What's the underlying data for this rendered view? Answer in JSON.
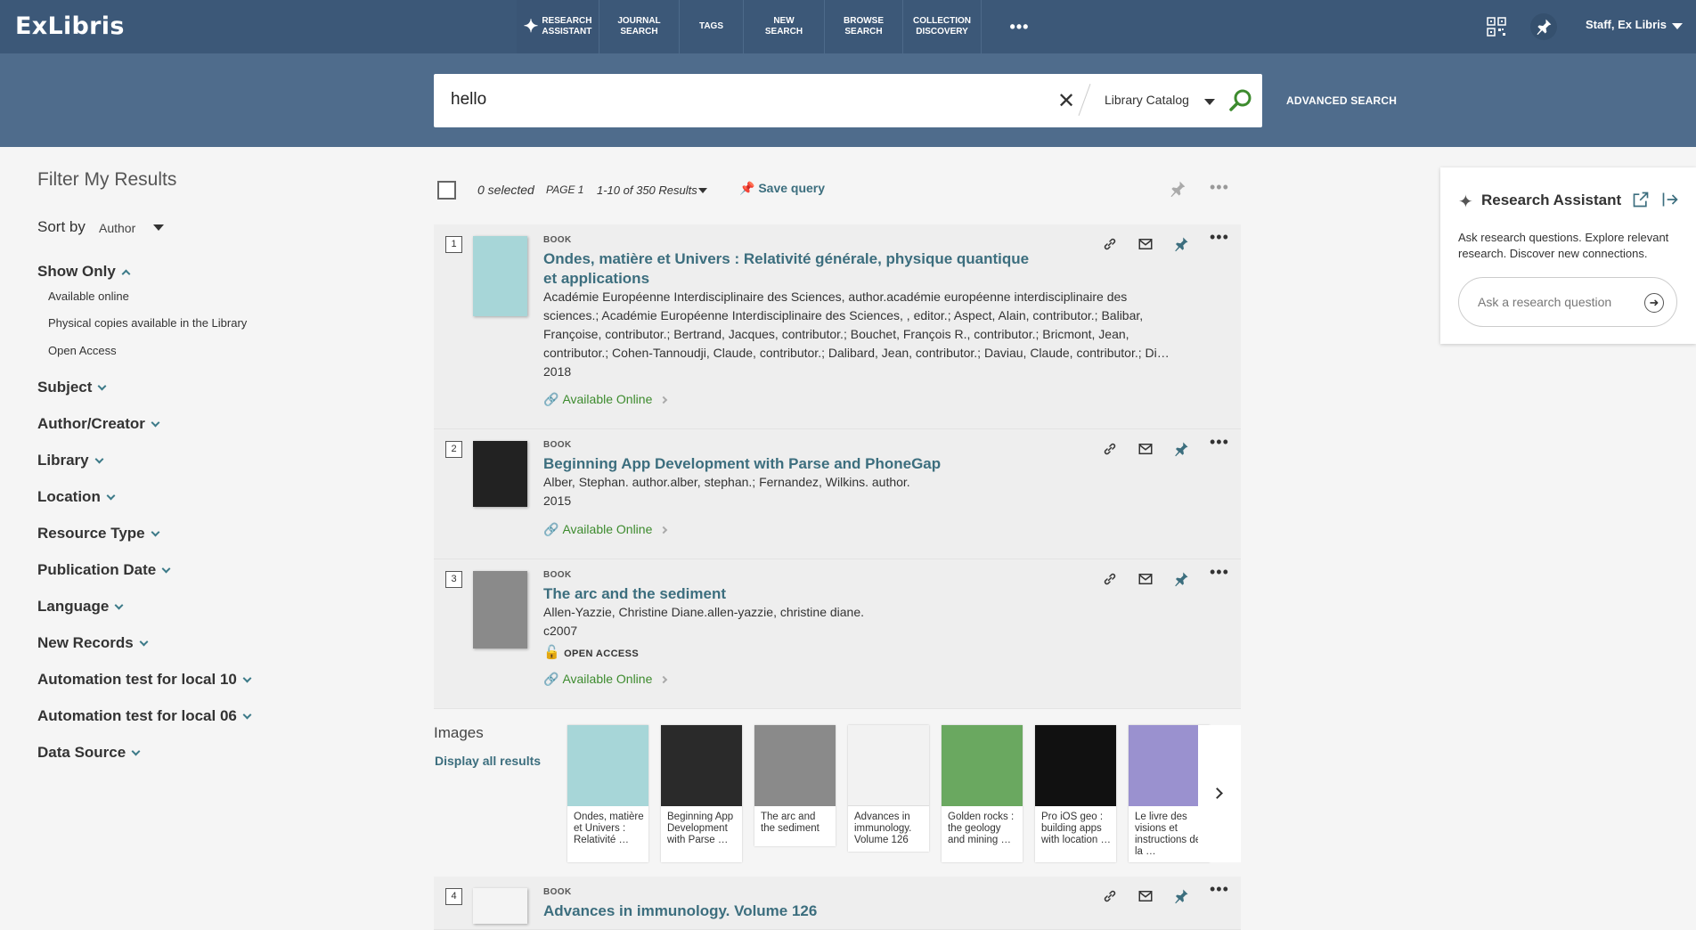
{
  "topbar": {
    "logo": "ExLibris",
    "nav": [
      "RESEARCH\nASSISTANT",
      "JOURNAL\nSEARCH",
      "TAGS",
      "NEW SEARCH",
      "BROWSE\nSEARCH",
      "COLLECTION\nDISCOVERY"
    ],
    "more": "•••",
    "user": "Staff, Ex Libris"
  },
  "search": {
    "value": "hello",
    "scope": "Library Catalog",
    "advanced": "ADVANCED SEARCH"
  },
  "filters": {
    "title": "Filter My Results",
    "sort_label": "Sort by",
    "sort_value": "Author",
    "show_only": "Show Only",
    "show_only_items": [
      "Available online",
      "Physical copies available in the Library",
      "Open Access"
    ],
    "facets": [
      "Subject",
      "Author/Creator",
      "Library",
      "Location",
      "Resource Type",
      "Publication Date",
      "Language",
      "New Records",
      "Automation test for local 10",
      "Automation test for local 06",
      "Data Source"
    ]
  },
  "toolbar": {
    "selected": "0 selected",
    "page": "PAGE 1",
    "range": "1-10 of 350 Results",
    "save_query": "Save query",
    "more": "•••"
  },
  "results": [
    {
      "num": "1",
      "type": "BOOK",
      "title": "Ondes, matière et Univers : Relativité générale, physique quantique et applications",
      "authors": "Académie Européenne Interdisciplinaire des Sciences, author.académie européenne interdisciplinaire des sciences.; Académie Européenne Interdisciplinaire des Sciences, , editor.; Aspect, Alain, contributor.; Balibar, Françoise, contributor.; Bertrand, Jacques, contributor.; Bouchet, François R., contributor.; Bricmont, Jean, contributor.; Cohen-Tannoudji, Claude, contributor.; Dalibard, Jean, contributor.; Daviau, Claude, contributor.; Di…",
      "year": "2018",
      "availability": "Available Online",
      "color": "#a7d6d8"
    },
    {
      "num": "2",
      "type": "BOOK",
      "title": "Beginning App Development with Parse and PhoneGap",
      "authors": "Alber, Stephan. author.alber, stephan.; Fernandez, Wilkins. author.",
      "year": "2015",
      "availability": "Available Online",
      "color": "#222222"
    },
    {
      "num": "3",
      "type": "BOOK",
      "title": "The arc and the sediment",
      "authors": "Allen-Yazzie, Christine Diane.allen-yazzie, christine diane.",
      "year": "c2007",
      "access": "OPEN ACCESS",
      "availability": "Available Online",
      "color": "#8a8a8a"
    },
    {
      "num": "4",
      "type": "BOOK",
      "title": "Advances in immunology. Volume 126"
    }
  ],
  "images": {
    "label": "Images",
    "display_all": "Display all results",
    "tiles": [
      {
        "caption": "Ondes, matière et Univers : Relativité …",
        "color": "#a7d6d8"
      },
      {
        "caption": "Beginning App Development with Parse …",
        "color": "#2a2a2a"
      },
      {
        "caption": "The arc and the sediment",
        "color": "#8a8a8a"
      },
      {
        "caption": "Advances in immunology. Volume 126",
        "color": "#f2f2f2"
      },
      {
        "caption": "Golden rocks : the geology and mining …",
        "color": "#6aa860"
      },
      {
        "caption": "Pro iOS geo : building apps with location …",
        "color": "#111111"
      },
      {
        "caption": "Le livre des visions et instructions de la …",
        "color": "#9a91cf"
      }
    ]
  },
  "research_assistant": {
    "title": "Research Assistant",
    "description": "Ask research questions. Explore relevant research. Discover new connections.",
    "placeholder": "Ask a research question"
  }
}
